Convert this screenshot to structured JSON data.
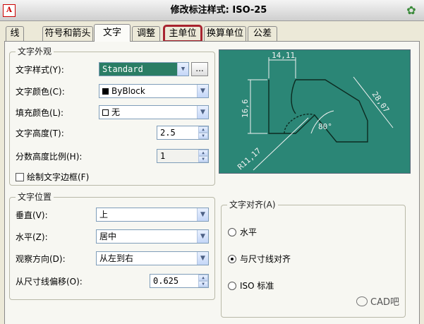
{
  "window": {
    "title": "修改标注样式: ISO-25",
    "logo_text": "A",
    "options_icon": "gear-icon"
  },
  "tabs": [
    {
      "label": "线",
      "active": false
    },
    {
      "label": "符号和箭头",
      "active": false
    },
    {
      "label": "文字",
      "active": true
    },
    {
      "label": "调整",
      "active": false
    },
    {
      "label": "主单位",
      "active": false,
      "highlighted": true
    },
    {
      "label": "换算单位",
      "active": false
    },
    {
      "label": "公差",
      "active": false
    }
  ],
  "text_appearance": {
    "title": "文字外观",
    "style_label": "文字样式(Y):",
    "style_value": "Standard",
    "style_browse": "...",
    "color_label": "文字颜色(C):",
    "color_value": "ByBlock",
    "fill_label": "填充颜色(L):",
    "fill_value": "无",
    "height_label": "文字高度(T):",
    "height_value": "2.5",
    "fraction_label": "分数高度比例(H):",
    "fraction_value": "1",
    "frame_label": "绘制文字边框(F)",
    "frame_checked": false
  },
  "text_placement": {
    "title": "文字位置",
    "vertical_label": "垂直(V):",
    "vertical_value": "上",
    "horizontal_label": "水平(Z):",
    "horizontal_value": "居中",
    "view_dir_label": "观察方向(D):",
    "view_dir_value": "从左到右",
    "offset_label": "从尺寸线偏移(O):",
    "offset_value": "0.625"
  },
  "preview": {
    "dim_top": "14,11",
    "dim_left": "16,6",
    "dim_right": "28,07",
    "dim_angle": "80°",
    "dim_radius": "R11,17"
  },
  "text_alignment": {
    "title": "文字对齐(A)",
    "options": [
      {
        "label": "水平",
        "selected": false
      },
      {
        "label": "与尺寸线对齐",
        "selected": true
      },
      {
        "label": "ISO 标准",
        "selected": false
      }
    ]
  },
  "watermark": "CAD吧",
  "colors": {
    "preview_bg": "#2b8676",
    "selected_field": "#2a7d64",
    "highlight": "#a8242f",
    "swatch_black": "#000000"
  }
}
